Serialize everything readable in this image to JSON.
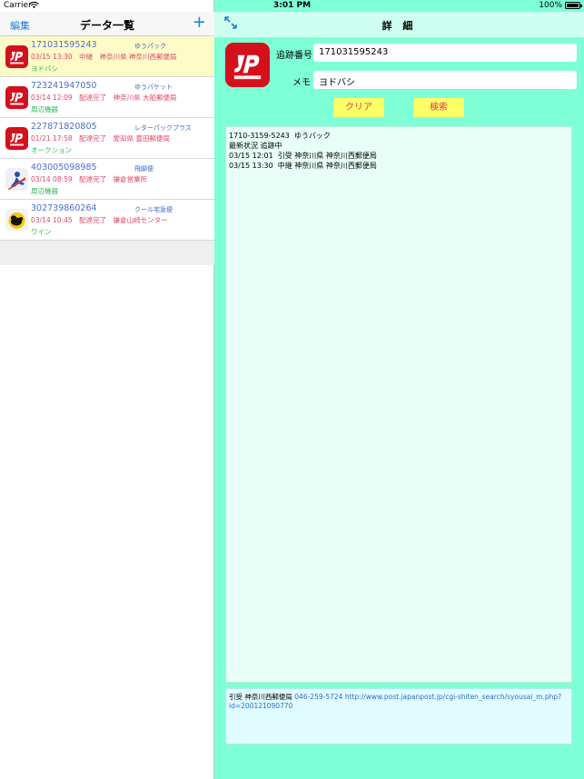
{
  "status_bar": {
    "carrier": "Carrier",
    "time": "3:01 PM",
    "battery": "100%"
  },
  "left_nav": {
    "edit_label": "編集",
    "title": "データ一覧",
    "add_label": "+"
  },
  "list": [
    {
      "number": "171031595243",
      "carrier": "ゆうパック",
      "status": "03/15 13:30　中継　神奈川県 神奈川西郵便局",
      "memo": "ヨドバシ",
      "icon": "japan-post-icon",
      "selected": true
    },
    {
      "number": "723241947050",
      "carrier": "ゆうパケット",
      "status": "03/14 12:09　配達完了　神奈川県 大船郵便局",
      "memo": "周辺機器",
      "icon": "japan-post-icon",
      "selected": false
    },
    {
      "number": "227871820805",
      "carrier": "レターパックプラス",
      "status": "01/21 17:58　配達完了　愛知県 豊田郵便局",
      "memo": "オークション",
      "icon": "japan-post-icon",
      "selected": false
    },
    {
      "number": "403005098985",
      "carrier": "飛脚便",
      "status": "03/14 08:59　配達完了　鎌倉営業所",
      "memo": "周辺機器",
      "icon": "sagawa-icon",
      "selected": false
    },
    {
      "number": "302739860264",
      "carrier": "クール宅急便",
      "status": "03/14 10:45　配達完了　鎌倉山崎センター",
      "memo": "ワイン",
      "icon": "yamato-icon",
      "selected": false
    }
  ],
  "right_nav": {
    "title": "詳 細"
  },
  "detail": {
    "track_label": "追跡番号",
    "track_value": "171031595243",
    "memo_label": "メモ",
    "memo_value": "ヨドバシ",
    "clear_label": "クリア",
    "search_label": "検索",
    "result_lines": [
      "1710-3159-5243  ゆうパック",
      "最新状況 追跡中",
      "03/15 12:01  引受 神奈川県 神奈川西郵便局",
      "03/15 13:30  中継 神奈川県 神奈川西郵便局"
    ],
    "info": {
      "office": "引受 神奈川西郵便局",
      "tel": "046-259-5724",
      "url": "http://www.post.japanpost.jp/cgi-shiten_search/syousai_m.php?id=200121090770"
    }
  },
  "colors": {
    "accent": "#1a7de0",
    "status_red": "#e0466a",
    "memo_green": "#2fb75a",
    "panel_mint": "#7effd6",
    "japan_post_red": "#d4101c",
    "button_yellow": "#ffff66"
  }
}
